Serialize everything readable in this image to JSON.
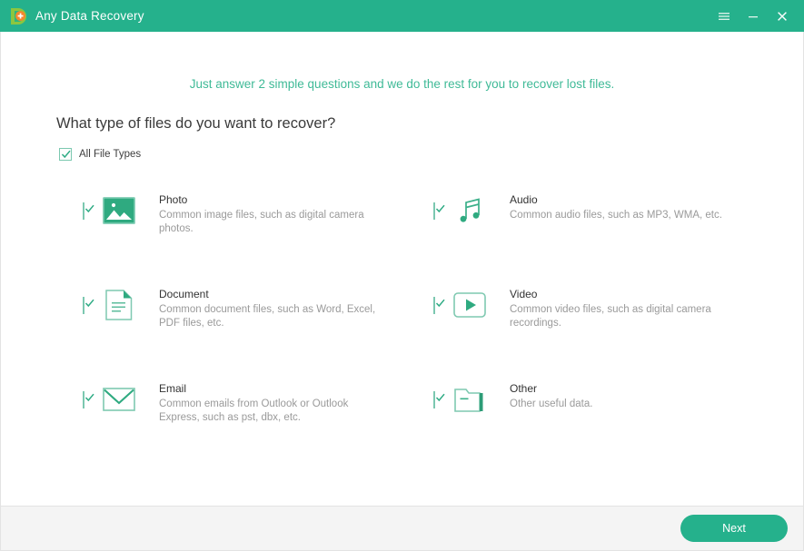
{
  "window": {
    "title": "Any Data Recovery",
    "logo_icon": "app-logo-icon",
    "controls": [
      {
        "name": "menu-button",
        "icon": "hamburger-icon",
        "label": "☰"
      },
      {
        "name": "minimize-button",
        "icon": "minimize-icon",
        "label": "–"
      },
      {
        "name": "close-button",
        "icon": "close-icon",
        "label": "×"
      }
    ],
    "colors": {
      "titlebar": "#25b18c",
      "accent": "#25b18c",
      "subtitle_text": "#3fba97",
      "heading_text": "#3a3a3a",
      "description_text": "#9a9a9a",
      "footer_bg": "#f4f4f4",
      "border": "#e3e3e3"
    }
  },
  "main": {
    "subtitle": "Just answer 2 simple questions and we do the rest for you to recover lost files.",
    "question": "What type of files do you want to recover?",
    "all_file_types": {
      "label": "All File Types",
      "checked": true
    },
    "file_types": [
      {
        "id": "photo",
        "title": "Photo",
        "description": "Common image files, such as digital camera photos.",
        "icon": "photo-icon",
        "checked": true
      },
      {
        "id": "audio",
        "title": "Audio",
        "description": "Common audio files, such as MP3, WMA, etc.",
        "icon": "audio-icon",
        "checked": true
      },
      {
        "id": "document",
        "title": "Document",
        "description": "Common document files, such as Word, Excel, PDF files, etc.",
        "icon": "document-icon",
        "checked": true
      },
      {
        "id": "video",
        "title": "Video",
        "description": "Common video files, such as digital camera recordings.",
        "icon": "video-icon",
        "checked": true
      },
      {
        "id": "email",
        "title": "Email",
        "description": "Common emails from Outlook or Outlook Express, such as pst, dbx, etc.",
        "icon": "email-icon",
        "checked": true
      },
      {
        "id": "other",
        "title": "Other",
        "description": "Other useful data.",
        "icon": "other-folder-icon",
        "checked": true
      }
    ]
  },
  "footer": {
    "next_label": "Next"
  }
}
